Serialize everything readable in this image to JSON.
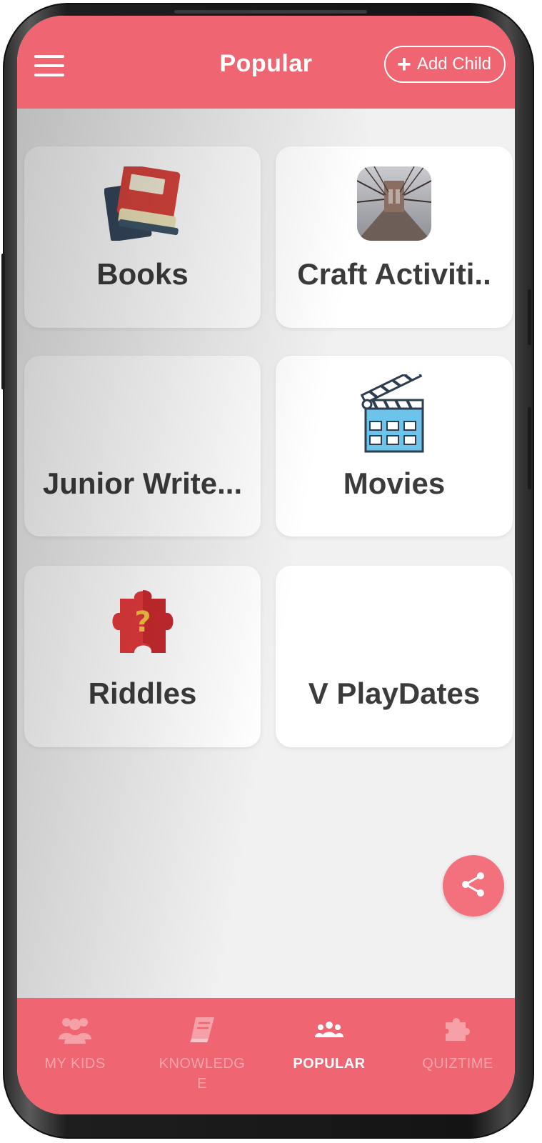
{
  "header": {
    "title": "Popular",
    "add_child_label": "Add Child"
  },
  "cards": [
    {
      "label": "Books",
      "icon": "books-icon"
    },
    {
      "label": "Craft Activiti..",
      "icon": "bridge-photo-icon"
    },
    {
      "label": "Junior Write...",
      "icon": ""
    },
    {
      "label": "Movies",
      "icon": "clapperboard-icon"
    },
    {
      "label": "Riddles",
      "icon": "puzzle-question-icon"
    },
    {
      "label": "V PlayDates",
      "icon": ""
    }
  ],
  "fab": {
    "icon": "share-icon"
  },
  "bottom_nav": [
    {
      "label": "MY KIDS",
      "icon": "group-icon",
      "active": false
    },
    {
      "label": "KNOWLEDGE",
      "icon": "book-icon",
      "active": false
    },
    {
      "label": "POPULAR",
      "icon": "people-icon",
      "active": true
    },
    {
      "label": "QUIZTIME",
      "icon": "puzzle-icon",
      "active": false
    }
  ],
  "colors": {
    "accent": "#ef6572",
    "background": "#f1f1f1",
    "card": "#ffffff",
    "label_text": "#3b3b3b"
  }
}
